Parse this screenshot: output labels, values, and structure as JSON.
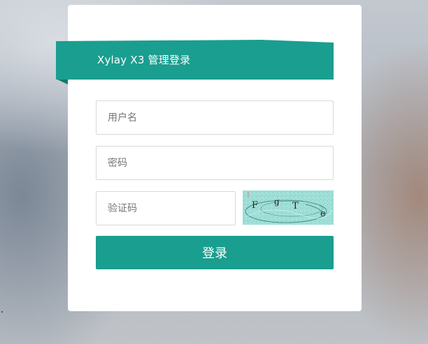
{
  "login": {
    "title": "Xylay X3 管理登录",
    "username_placeholder": "用户名",
    "password_placeholder": "密码",
    "captcha_placeholder": "验证码",
    "captcha_chars": [
      "F",
      "g",
      "T",
      "e"
    ],
    "submit_label": "登录"
  },
  "colors": {
    "accent": "#1a9e8f",
    "accent_dark": "#127a6e",
    "card": "#ffffff",
    "captcha_bg": "#9edfd8"
  }
}
